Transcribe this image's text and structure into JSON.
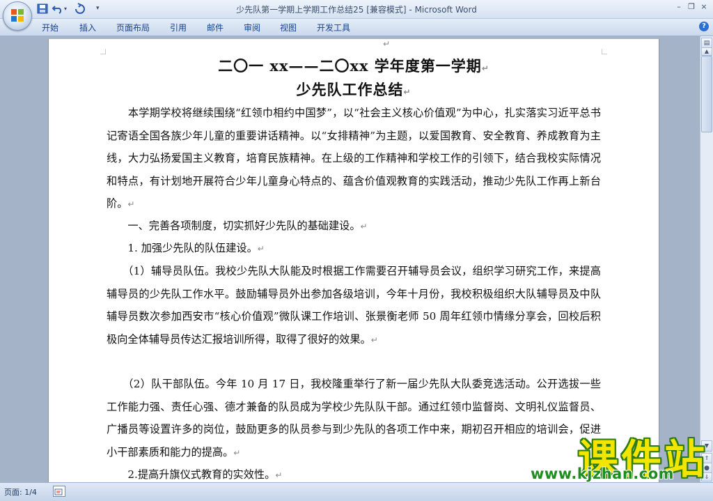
{
  "window": {
    "title_doc": "少先队第一学期上学期工作总结25 [兼容模式]",
    "title_sep": " - ",
    "title_app": "Microsoft Word",
    "controls": [
      "–",
      "❐",
      "×"
    ]
  },
  "ribbon": {
    "tabs": [
      "开始",
      "插入",
      "页面布局",
      "引用",
      "邮件",
      "审阅",
      "视图",
      "开发工具"
    ],
    "help": "?"
  },
  "document": {
    "heading1": "二〇一 xx——二〇xx 学年度第一学期",
    "heading2": "少先队工作总结",
    "top_mark": "↵",
    "para_mark": "↵",
    "paragraphs": [
      "　　本学期学校将继续围绕“红领巾相约中国梦”，以“社会主义核心价值观”为中心，扎实落实习近平总书记寄语全国各族少年儿童的重要讲话精神。以“女排精神”为主题，以爱国教育、安全教育、养成教育为主线，大力弘扬爱国主义教育，培育民族精神。在上级的工作精神和学校工作的引领下，结合我校实际情况和特点，有计划地开展符合少年儿童身心特点的、蕴含价值观教育的实践活动，推动少先队工作再上新台阶。",
      "　　一、完善各项制度，切实抓好少先队的基础建设。",
      "　　1. 加强少先队的队伍建设。",
      "　　（1）辅导员队伍。我校少先队大队能及时根据工作需要召开辅导员会议，组织学习研究工作，来提高辅导员的少先队工作水平。鼓励辅导员外出参加各级培训，今年十月份，我校积极组织大队辅导员及中队辅导员数次参加西安市“核心价值观”微队课工作培训、张景衡老师 50 周年红领巾情缘分享会，回校后积极向全体辅导员传达汇报培训所得，取得了很好的效果。",
      "　　（2）队干部队伍。今年 10 月 17 日，我校隆重举行了新一届少先队大队委竞选活动。公开选拔一些工作能力强、责任心强、德才兼备的队员成为学校少先队队干部。通过红领巾监督岗、文明礼仪监督员、广播员等设置许多的岗位，鼓励更多的队员参与到少先队的各项工作中来，期初召开相应的培训会，促进小干部素质和能力的提高。",
      "　　2.提高升旗仪式教育的实效性。"
    ]
  },
  "statusbar": {
    "page_label": "页面: 1/4"
  },
  "watermark": {
    "text_cn": "课件站",
    "url": "www.kjzhan.com"
  },
  "colors": {
    "ribbon_text": "#15428b",
    "watermark_yellow": "#f2e600",
    "watermark_green": "#2b7a12"
  }
}
